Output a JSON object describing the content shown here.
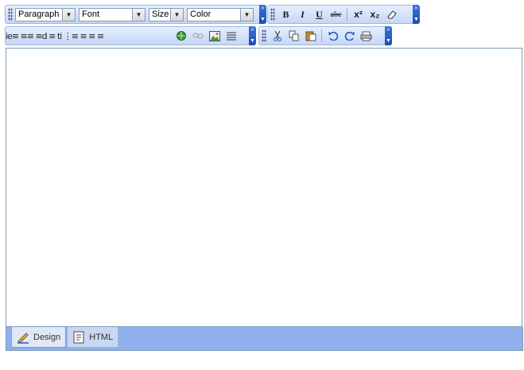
{
  "toolbar_row1": {
    "format_block": {
      "value": "Paragraph"
    },
    "font_name": {
      "value": "Font"
    },
    "font_size": {
      "value": "Size"
    },
    "font_color": {
      "value": "Color"
    },
    "bold_label": "B",
    "italic_label": "I",
    "underline_label": "U",
    "strike_label": "abc",
    "superscript_label": "x²",
    "subscript_label": "x₂",
    "overflow_label": "»"
  },
  "toolbar_row2": {
    "glyph_strip": "ie≡ ≡≡ ≡d ≡ ti ⋮≡ ≡ ≡ ≡"
  },
  "mode_tabs": [
    {
      "label": "Design",
      "icon": "design-icon",
      "active": true
    },
    {
      "label": "HTML",
      "icon": "html-icon",
      "active": false
    }
  ],
  "colors": {
    "toolbar_bg": "#c5d7f6",
    "toolbar_accent": "#1e4cb0",
    "bottom_bar": "#8fb0ec",
    "border": "#7f9db9"
  }
}
